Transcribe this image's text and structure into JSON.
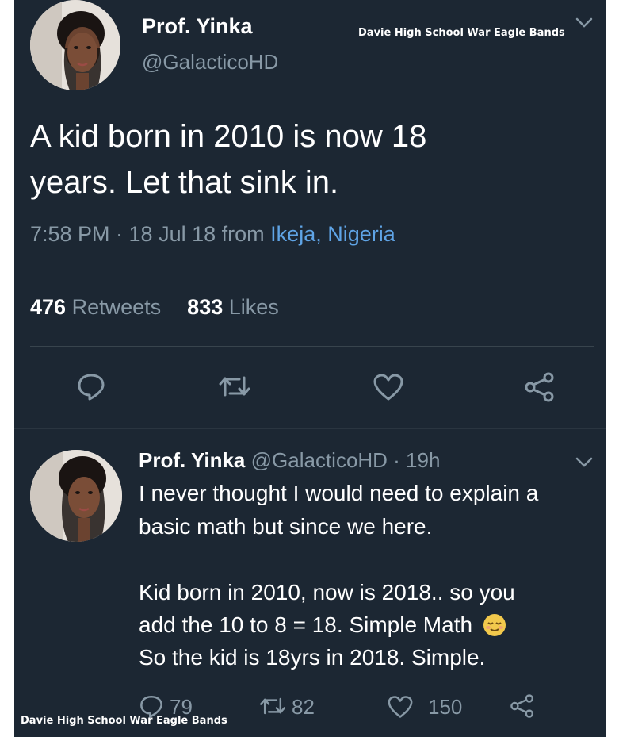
{
  "watermark": "Davie High School War Eagle Bands",
  "main_tweet": {
    "name": "Prof. Yinka",
    "handle": "@GalacticoHD",
    "text_line1": "A kid born in 2010 is now 18",
    "text_line2": "years. Let that sink in.",
    "time": "7:58 PM · 18 Jul 18",
    "from_label": "from",
    "location": "Ikeja, Nigeria",
    "retweets_count": "476",
    "retweets_label": "Retweets",
    "likes_count": "833",
    "likes_label": "Likes"
  },
  "reply_tweet": {
    "name": "Prof. Yinka",
    "handle_time": "@GalacticoHD · 19h",
    "line1": "I never thought I would need to explain a",
    "line2": "basic math but since we here.",
    "line3": "Kid born in 2010, now is 2018.. so you",
    "line4": "add the 10 to 8 = 18. Simple Math",
    "line5": "So the kid is 18yrs in 2018. Simple.",
    "reply_count": "79",
    "retweet_count": "82",
    "like_count": "150"
  },
  "colors": {
    "background": "#1c2733",
    "text": "#ffffff",
    "muted": "#8899a6",
    "link": "#5fa4e6"
  },
  "icons": [
    "chevron-down-icon",
    "reply-icon",
    "retweet-icon",
    "heart-icon",
    "share-icon",
    "relieved-face-emoji"
  ]
}
